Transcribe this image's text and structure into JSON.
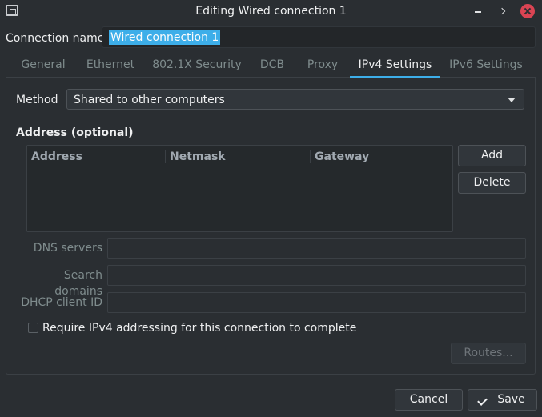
{
  "window": {
    "title": "Editing Wired connection 1"
  },
  "connection": {
    "label": "Connection name",
    "value": "Wired connection 1"
  },
  "tabs": [
    {
      "label": "General",
      "active": false
    },
    {
      "label": "Ethernet",
      "active": false
    },
    {
      "label": "802.1X Security",
      "active": false
    },
    {
      "label": "DCB",
      "active": false
    },
    {
      "label": "Proxy",
      "active": false
    },
    {
      "label": "IPv4 Settings",
      "active": true
    },
    {
      "label": "IPv6 Settings",
      "active": false
    }
  ],
  "ipv4": {
    "method_label": "Method",
    "method_value": "Shared to other computers",
    "address_heading": "Address (optional)",
    "columns": [
      "Address",
      "Netmask",
      "Gateway"
    ],
    "add_label": "Add",
    "delete_label": "Delete",
    "dns_label": "DNS servers",
    "search_label": "Search domains",
    "dhcp_label": "DHCP client ID",
    "require_label": "Require IPv4 addressing for this connection to complete",
    "require_checked": false,
    "routes_label": "Routes..."
  },
  "footer": {
    "cancel_label": "Cancel",
    "save_label": "Save"
  },
  "colors": {
    "background": "#2a2e32",
    "accent": "#3daee9",
    "close": "#da4453"
  }
}
